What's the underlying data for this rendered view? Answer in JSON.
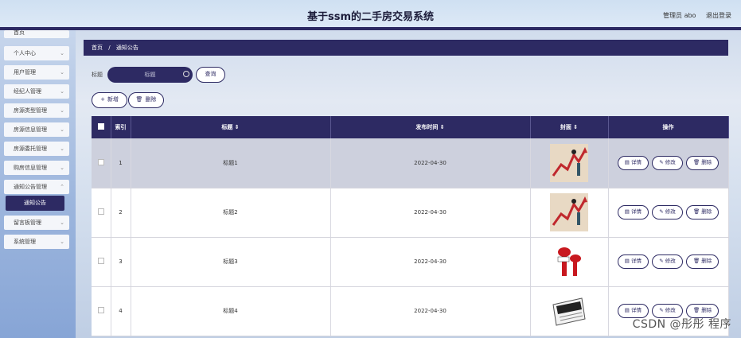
{
  "header": {
    "title": "基于ssm的二手房交易系统",
    "user_label": "管理员 abo",
    "logout_label": "退出登录"
  },
  "sidebar": {
    "items": [
      {
        "label": "首页",
        "has_children": false
      },
      {
        "label": "个人中心",
        "has_children": true
      },
      {
        "label": "用户管理",
        "has_children": true
      },
      {
        "label": "经纪人管理",
        "has_children": true
      },
      {
        "label": "房源类型管理",
        "has_children": true
      },
      {
        "label": "房源信息管理",
        "has_children": true
      },
      {
        "label": "房源委托管理",
        "has_children": true
      },
      {
        "label": "购房信息管理",
        "has_children": true
      },
      {
        "label": "通知公告管理",
        "has_children": true
      },
      {
        "label": "通知公告",
        "active_sub": true
      },
      {
        "label": "留言板管理",
        "has_children": true
      },
      {
        "label": "系统管理",
        "has_children": true
      }
    ]
  },
  "breadcrumb": {
    "home": "首页",
    "separator": "/",
    "current": "通知公告"
  },
  "search": {
    "label": "标题",
    "placeholder": "标题",
    "query_button": "查询"
  },
  "actions": {
    "add_label": "新增",
    "delete_label": "删除"
  },
  "table": {
    "columns": [
      "索引",
      "标题 ⇕",
      "发布时间 ⇕",
      "封面 ⇕",
      "操作"
    ],
    "rows": [
      {
        "index": "1",
        "title": "标题1",
        "date": "2022-04-30",
        "cover": "chart-arrow-image",
        "hover": true
      },
      {
        "index": "2",
        "title": "标题2",
        "date": "2022-04-30",
        "cover": "chart-arrow-image",
        "hover": false
      },
      {
        "index": "3",
        "title": "标题3",
        "date": "2022-04-30",
        "cover": "microphones-image",
        "hover": false
      },
      {
        "index": "4",
        "title": "标题4",
        "date": "2022-04-30",
        "cover": "news-paper-image",
        "hover": false
      }
    ],
    "row_actions": {
      "detail": "详情",
      "edit": "修改",
      "delete": "删除"
    }
  },
  "watermark": "CSDN @彤彤 程序",
  "colors": {
    "primary": "#2d2a63",
    "hover_row": "#cdd0dd"
  }
}
